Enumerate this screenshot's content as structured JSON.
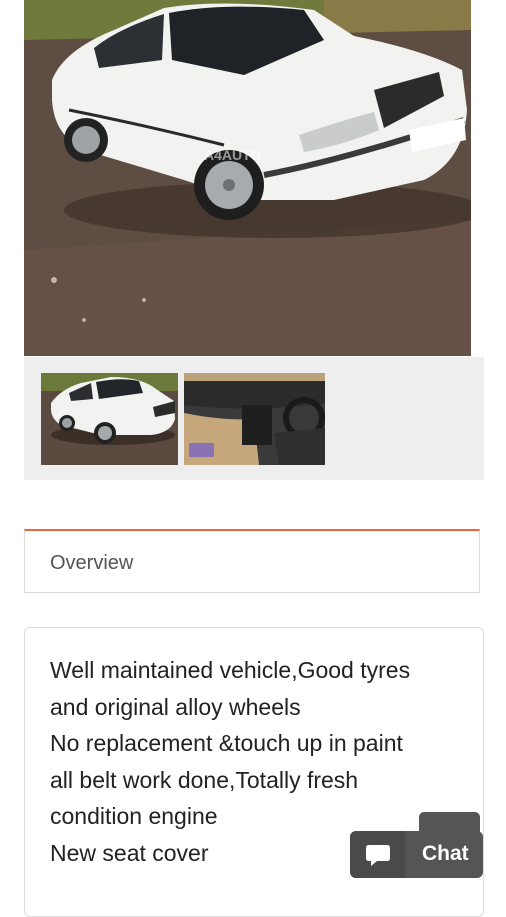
{
  "gallery": {
    "main_watermark": "A4AUTO",
    "thumbnails": [
      {
        "label": "Exterior photo thumbnail"
      },
      {
        "label": "Interior photo thumbnail"
      }
    ]
  },
  "tabs": {
    "overview_label": "Overview",
    "active_color": "#f0643a"
  },
  "description": {
    "lines": [
      "Well maintained vehicle,Good tyres",
      "and original alloy wheels",
      "No replacement &touch up in paint",
      "all belt work done,Totally fresh",
      "condition engine",
      "New seat cover"
    ]
  },
  "chat": {
    "label": "Chat",
    "icon": "chat-bubble-icon"
  }
}
